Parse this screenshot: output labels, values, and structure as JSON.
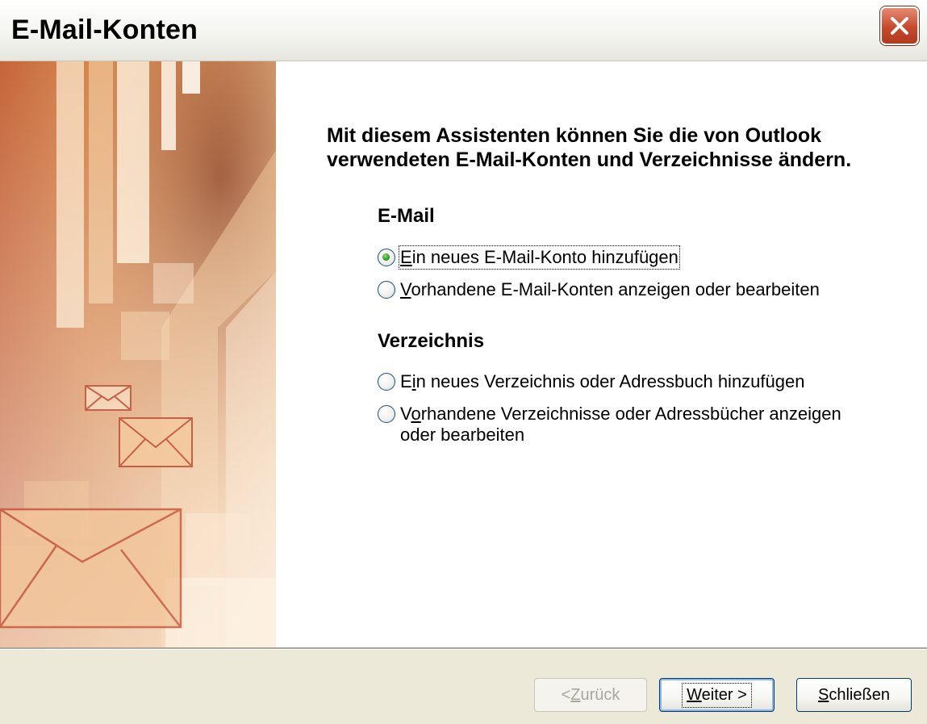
{
  "window": {
    "title": "E-Mail-Konten"
  },
  "content": {
    "heading": "Mit diesem Assistenten können Sie die von Outlook verwendeten E-Mail-Konten und Verzeichnisse ändern.",
    "sections": [
      {
        "title": "E-Mail",
        "options": [
          {
            "mnemonic": "E",
            "rest": "in neues E-Mail-Konto hinzufügen",
            "checked": true
          },
          {
            "mnemonic": "V",
            "rest": "orhandene E-Mail-Konten anzeigen oder bearbeiten",
            "checked": false
          }
        ]
      },
      {
        "title": "Verzeichnis",
        "options": [
          {
            "pre": "E",
            "mnemonic": "i",
            "rest": "n neues Verzeichnis oder Adressbuch hinzufügen",
            "checked": false
          },
          {
            "pre": "V",
            "mnemonic": "o",
            "rest": "rhandene Verzeichnisse oder Adressbücher anzeigen",
            "line2": "oder bearbeiten",
            "checked": false
          }
        ]
      }
    ]
  },
  "buttons": {
    "back": {
      "pre": "< ",
      "mnemonic": "Z",
      "rest": "urück",
      "enabled": false
    },
    "next": {
      "mnemonic": "W",
      "rest": "eiter >",
      "enabled": true,
      "default": true
    },
    "close": {
      "mnemonic": "S",
      "rest": "chließen",
      "enabled": true
    }
  },
  "colors": {
    "title_close": "#c7492c",
    "radio_checked": "#2a9d1f",
    "footer_bg": "#ece9d8",
    "art_orange": "#d98d55"
  }
}
